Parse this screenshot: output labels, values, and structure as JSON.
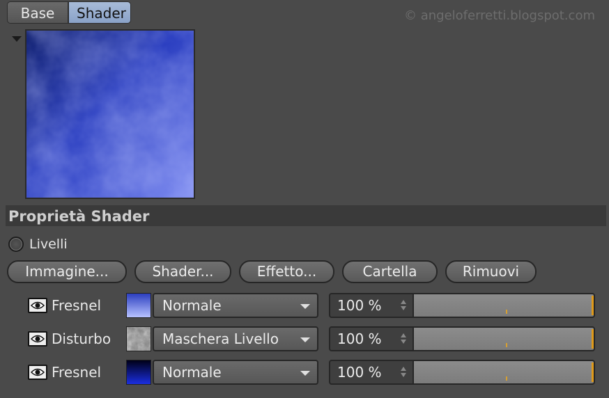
{
  "tabs": [
    {
      "label": "Base",
      "active": false
    },
    {
      "label": "Shader",
      "active": true
    }
  ],
  "watermark": "© angeloferretti.blogspot.com",
  "section": {
    "title": "Proprietà Shader"
  },
  "mode": {
    "label": "Livelli"
  },
  "buttons": [
    {
      "label": "Immagine..."
    },
    {
      "label": "Shader..."
    },
    {
      "label": "Effetto..."
    },
    {
      "label": "Cartella"
    },
    {
      "label": "Rimuovi"
    }
  ],
  "layers": [
    {
      "name": "Fresnel",
      "blend_mode": "Normale",
      "opacity": "100 %",
      "opacity_value": 1.0,
      "thumb": "gradient-light-blue",
      "visible": true
    },
    {
      "name": "Disturbo",
      "blend_mode": "Maschera Livello",
      "opacity": "100 %",
      "opacity_value": 1.0,
      "thumb": "noise-gray",
      "visible": true
    },
    {
      "name": "Fresnel",
      "blend_mode": "Normale",
      "opacity": "100 %",
      "opacity_value": 1.0,
      "thumb": "gradient-dark-blue",
      "visible": true
    }
  ],
  "colors": {
    "accent": "#e09a1a",
    "tab_active": "#8aa2c8",
    "background": "#4a4a4a"
  },
  "icons": {
    "collapse": "triangle-down-icon",
    "visibility": "eye-icon"
  }
}
